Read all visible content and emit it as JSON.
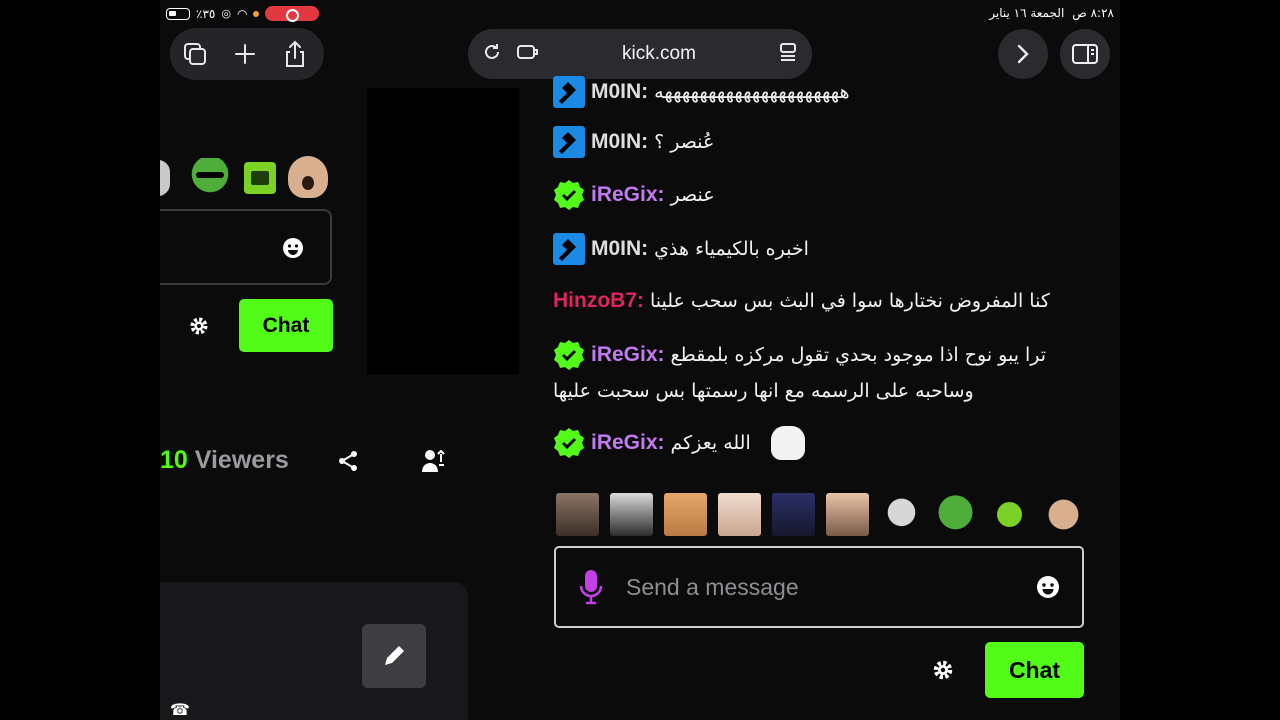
{
  "status_bar": {
    "time": "٨:٢٨ ص",
    "date": "الجمعة ١٦ يناير",
    "battery": "٪٣٥"
  },
  "browser": {
    "url": "kick.com"
  },
  "left_panel": {
    "chat_button": "Chat",
    "viewers_count": "10",
    "viewers_label": "Viewers"
  },
  "chat": {
    "messages": [
      {
        "user": "M0IN:",
        "text": "هههههههههههههههههههههه",
        "badge": "moderator-badge"
      },
      {
        "user": "M0IN:",
        "text": "عُنصر ؟",
        "badge": "moderator-badge"
      },
      {
        "user": "iReGix:",
        "text": "عنصر",
        "badge": "verified-badge"
      },
      {
        "user": "M0IN:",
        "text": "اخبره بالكيمياء هذي",
        "badge": "moderator-badge"
      },
      {
        "user": "HinzoB7:",
        "text": "كنا المفروض نختارها سوا في البث بس سحب علينا",
        "badge": ""
      },
      {
        "user": "iReGix:",
        "text": "ترا يبو نوح اذا موجود بحدي تقول مركزه بلمقطع",
        "text2": "وساحبه على الرسمه مع انها رسمتها بس سحبت عليها",
        "badge": "verified-badge"
      },
      {
        "user": "iReGix:",
        "text": "الله يعزكم",
        "badge": "verified-badge"
      }
    ],
    "input_placeholder": "Send a message",
    "chat_button": "Chat"
  },
  "colors": {
    "accent": "#53fc18",
    "mod_name": "#dedede",
    "verified_name": "#c27cf0",
    "hinzo_name": "#e0245e"
  }
}
